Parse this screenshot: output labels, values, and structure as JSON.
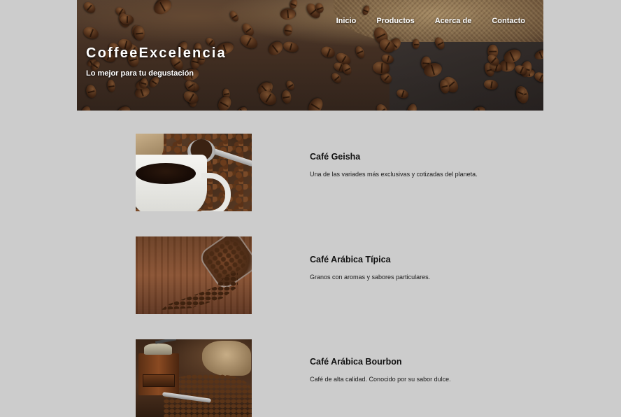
{
  "header": {
    "brand": {
      "part1": "Coffee",
      "part2": "Excelencia"
    },
    "tagline": "Lo mejor para tu degustación",
    "nav": [
      {
        "label": "Inicio"
      },
      {
        "label": "Productos"
      },
      {
        "label": "Acerca de"
      },
      {
        "label": "Contacto"
      }
    ]
  },
  "products": [
    {
      "title": "Café Geisha",
      "description": "Una de las variades más exclusivas y cotizadas del planeta."
    },
    {
      "title": "Café Arábica Típica",
      "description": "Granos con aromas y sabores particulares."
    },
    {
      "title": "Café Arábica Bourbon",
      "description": "Café de alta calidad. Conocido por su sabor dulce."
    }
  ],
  "colors": {
    "page_background": "#cccccc",
    "text_dark": "#111111",
    "header_text": "#ffffff"
  }
}
